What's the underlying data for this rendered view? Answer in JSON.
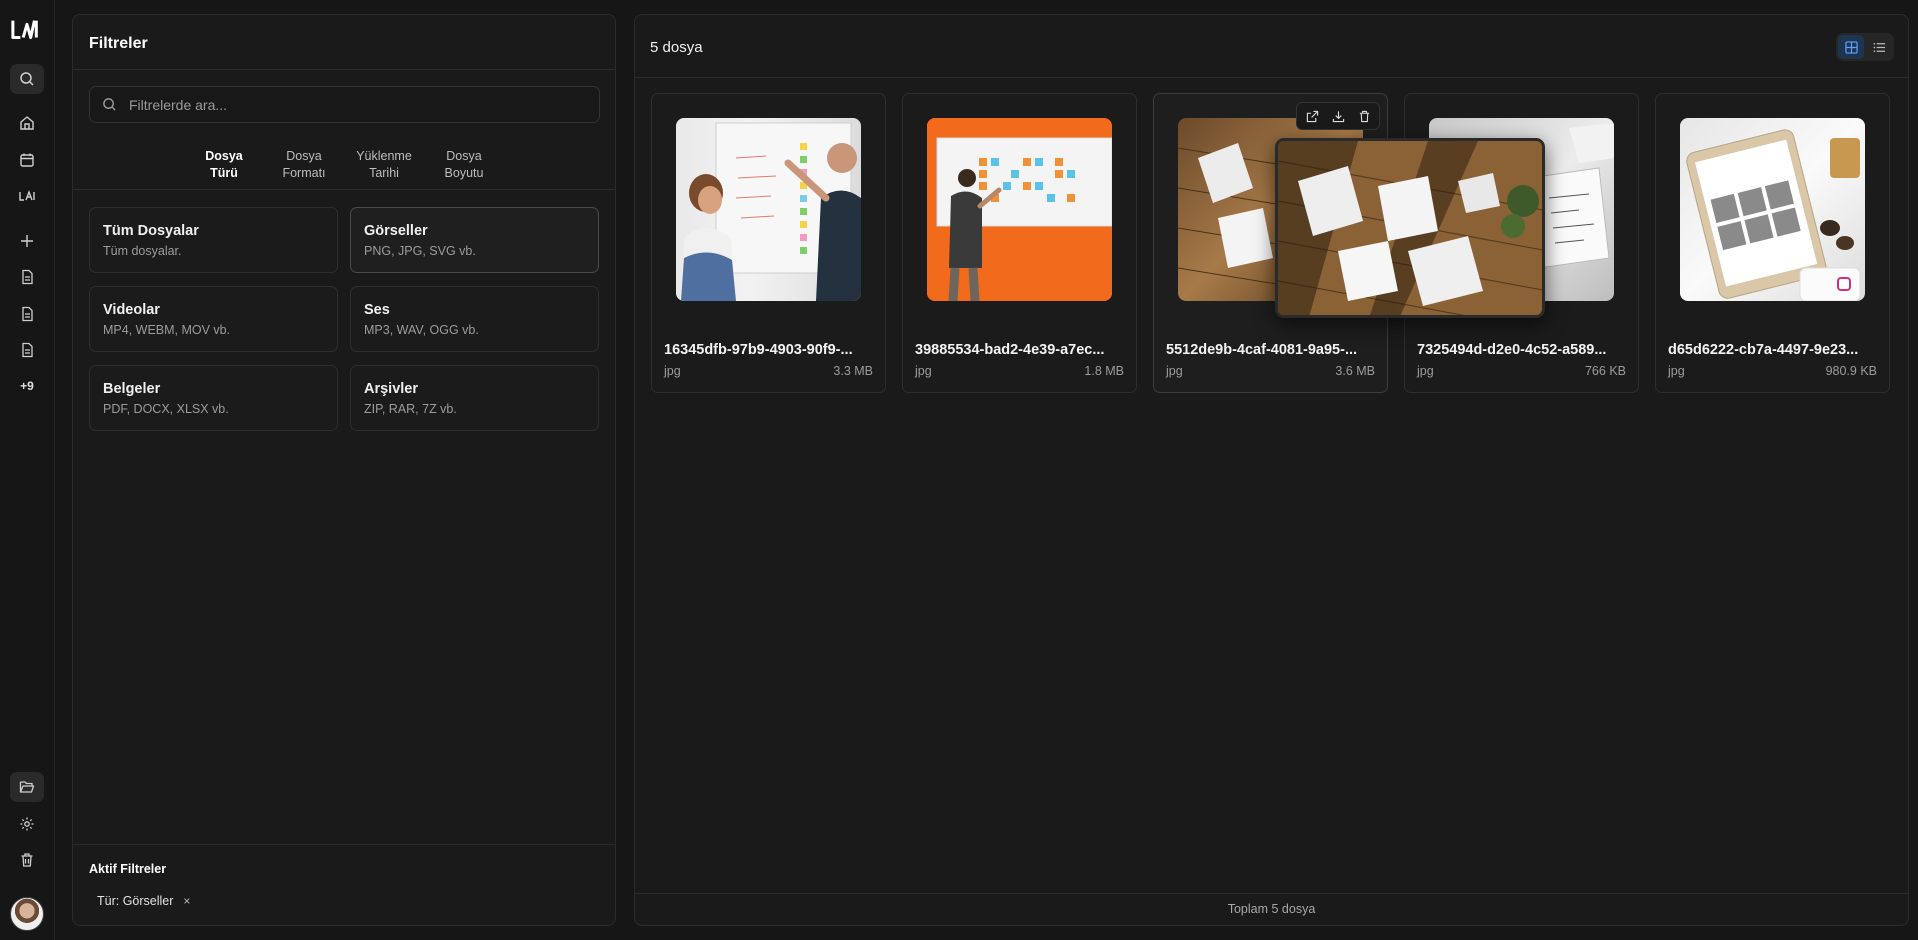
{
  "rail": {
    "plus_more": "+9"
  },
  "filters": {
    "title": "Filtreler",
    "search_placeholder": "Filtrelerde ara...",
    "tabs": [
      {
        "line1": "Dosya",
        "line2": "Türü"
      },
      {
        "line1": "Dosya",
        "line2": "Formatı"
      },
      {
        "line1": "Yüklenme",
        "line2": "Tarihi"
      },
      {
        "line1": "Dosya",
        "line2": "Boyutu"
      }
    ],
    "categories": [
      {
        "name": "Tüm Dosyalar",
        "desc": "Tüm dosyalar."
      },
      {
        "name": "Görseller",
        "desc": "PNG, JPG, SVG vb."
      },
      {
        "name": "Videolar",
        "desc": "MP4, WEBM, MOV vb."
      },
      {
        "name": "Ses",
        "desc": "MP3, WAV, OGG vb."
      },
      {
        "name": "Belgeler",
        "desc": "PDF, DOCX, XLSX vb."
      },
      {
        "name": "Arşivler",
        "desc": "ZIP, RAR, 7Z vb."
      }
    ],
    "active_title": "Aktif Filtreler",
    "active_chip": "Tür: Görseller",
    "active_chip_remove": "×"
  },
  "files": {
    "count_label": "5 dosya",
    "total_label": "Toplam 5 dosya",
    "items": [
      {
        "name": "16345dfb-97b9-4903-90f9-...",
        "ext": "jpg",
        "size": "3.3 MB"
      },
      {
        "name": "39885534-bad2-4e39-a7ec...",
        "ext": "jpg",
        "size": "1.8 MB"
      },
      {
        "name": "5512de9b-4caf-4081-9a95-...",
        "ext": "jpg",
        "size": "3.6 MB"
      },
      {
        "name": "7325494d-d2e0-4c52-a589...",
        "ext": "jpg",
        "size": "766 KB"
      },
      {
        "name": "d65d6222-cb7a-4497-9e23...",
        "ext": "jpg",
        "size": "980.9 KB"
      }
    ]
  }
}
